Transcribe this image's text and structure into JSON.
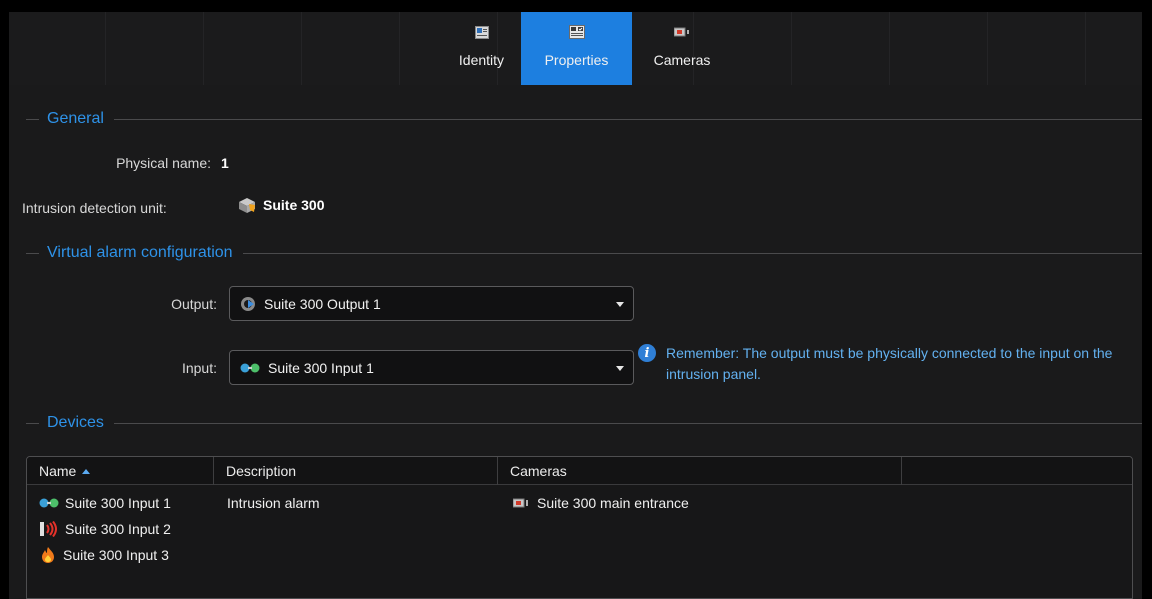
{
  "tabs": [
    {
      "label": "Identity",
      "icon": "identity-icon",
      "active": false
    },
    {
      "label": "Properties",
      "icon": "properties-icon",
      "active": true
    },
    {
      "label": "Cameras",
      "icon": "camera-icon",
      "active": false
    }
  ],
  "general": {
    "title": "General",
    "physical_name_label": "Physical name:",
    "physical_name_value": "1",
    "unit_label": "Intrusion detection unit:",
    "unit_value": "Suite 300",
    "unit_icon": "intrusion-unit-icon"
  },
  "virtual_alarm": {
    "title": "Virtual alarm configuration",
    "output_label": "Output:",
    "output_value": "Suite 300 Output 1",
    "input_label": "Input:",
    "input_value": "Suite 300 Input 1",
    "info_text": "Remember: The output must be physically connected to the input on the intrusion panel."
  },
  "devices": {
    "title": "Devices",
    "columns": [
      "Name",
      "Description",
      "Cameras",
      ""
    ],
    "sort_column": "Name",
    "sort_direction": "ascending",
    "rows": [
      {
        "name": "Suite 300 Input 1",
        "icon": "input-sensor-icon",
        "description": "Intrusion alarm",
        "camera": "Suite 300 main entrance"
      },
      {
        "name": "Suite 300 Input 2",
        "icon": "alarm-signal-icon",
        "description": "",
        "camera": ""
      },
      {
        "name": "Suite 300 Input 3",
        "icon": "fire-icon",
        "description": "",
        "camera": ""
      }
    ]
  },
  "colors": {
    "accent": "#1d7fe0",
    "section_title": "#2e92e8",
    "info_text": "#63b1f0",
    "background": "#1a1a1b"
  }
}
